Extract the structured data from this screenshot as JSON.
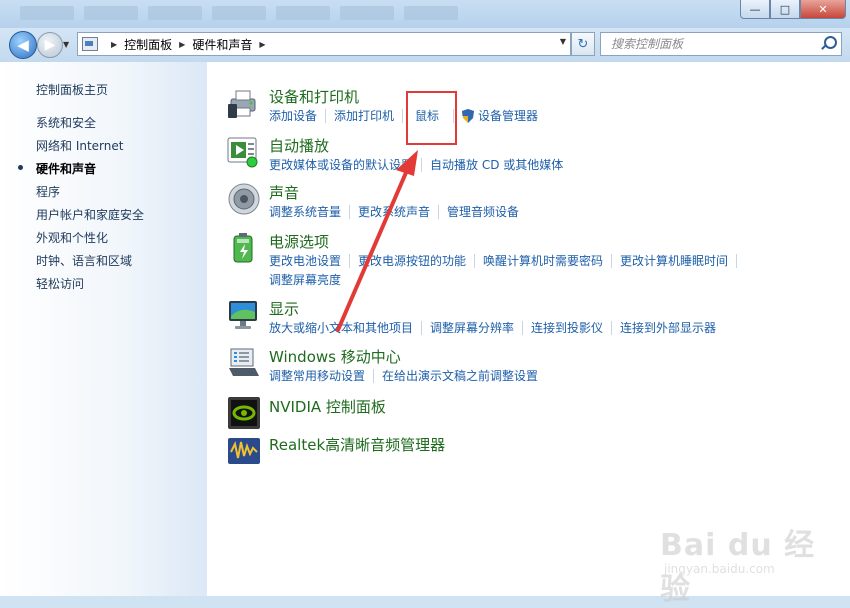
{
  "window": {
    "controls": [
      "—",
      "□",
      "✕"
    ]
  },
  "address": {
    "crumbs": [
      "控制面板",
      "硬件和声音"
    ]
  },
  "search": {
    "placeholder": "搜索控制面板"
  },
  "sidebar": {
    "home": "控制面板主页",
    "items": [
      {
        "label": "系统和安全",
        "current": false
      },
      {
        "label": "网络和 Internet",
        "current": false
      },
      {
        "label": "硬件和声音",
        "current": true
      },
      {
        "label": "程序",
        "current": false
      },
      {
        "label": "用户帐户和家庭安全",
        "current": false
      },
      {
        "label": "外观和个性化",
        "current": false
      },
      {
        "label": "时钟、语言和区域",
        "current": false
      },
      {
        "label": "轻松访问",
        "current": false
      }
    ]
  },
  "categories": {
    "devices": {
      "title": "设备和打印机",
      "icon": "printer-icon",
      "links": [
        "添加设备",
        "添加打印机",
        "鼠标",
        "设备管理器"
      ]
    },
    "autoplay": {
      "title": "自动播放",
      "icon": "autoplay-icon",
      "links": [
        "更改媒体或设备的默认设置",
        "自动播放 CD 或其他媒体"
      ]
    },
    "sound": {
      "title": "声音",
      "icon": "speaker-icon",
      "links": [
        "调整系统音量",
        "更改系统声音",
        "管理音频设备"
      ]
    },
    "power": {
      "title": "电源选项",
      "icon": "battery-icon",
      "links": [
        "更改电池设置",
        "更改电源按钮的功能",
        "唤醒计算机时需要密码",
        "更改计算机睡眠时间",
        "调整屏幕亮度"
      ]
    },
    "display": {
      "title": "显示",
      "icon": "monitor-icon",
      "links": [
        "放大或缩小文本和其他项目",
        "调整屏幕分辨率",
        "连接到投影仪",
        "连接到外部显示器"
      ]
    },
    "mobility": {
      "title": "Windows 移动中心",
      "icon": "laptop-icon",
      "links": [
        "调整常用移动设置",
        "在给出演示文稿之前调整设置"
      ]
    },
    "nvidia": {
      "title": "NVIDIA 控制面板",
      "icon": "nvidia-icon"
    },
    "realtek": {
      "title": "Realtek高清晰音频管理器",
      "icon": "realtek-icon"
    }
  },
  "annotation": {
    "color": "#e23a36"
  },
  "watermark": {
    "text": "Bai du 经验",
    "url": "jingyan.baidu.com"
  }
}
